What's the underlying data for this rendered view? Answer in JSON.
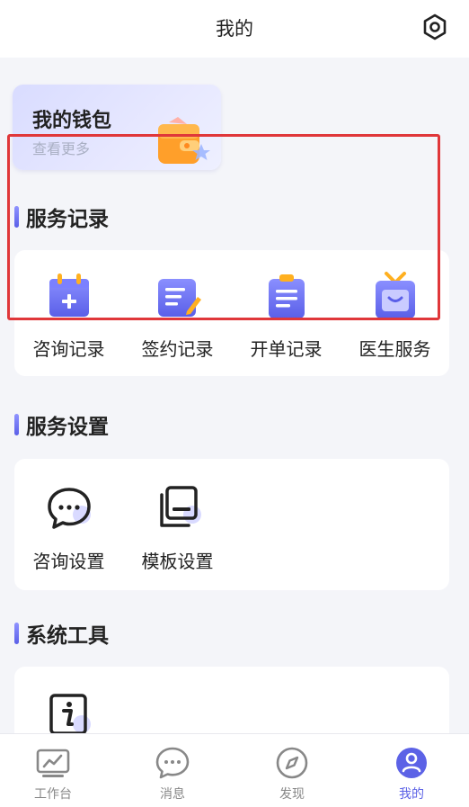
{
  "header": {
    "title": "我的",
    "settings_icon": "hexagon-settings-icon"
  },
  "wallet": {
    "title": "我的钱包",
    "subtitle": "查看更多",
    "icon": "wallet-icon"
  },
  "sections": {
    "service_records": {
      "title": "服务记录",
      "items": [
        {
          "label": "咨询记录",
          "icon": "calendar-plus-icon"
        },
        {
          "label": "签约记录",
          "icon": "sign-document-icon"
        },
        {
          "label": "开单记录",
          "icon": "clipboard-list-icon"
        },
        {
          "label": "医生服务",
          "icon": "doctor-service-icon"
        }
      ]
    },
    "service_settings": {
      "title": "服务设置",
      "items": [
        {
          "label": "咨询设置",
          "icon": "chat-settings-icon"
        },
        {
          "label": "模板设置",
          "icon": "template-settings-icon"
        }
      ]
    },
    "system_tools": {
      "title": "系统工具",
      "items": [
        {
          "label": "",
          "icon": "info-icon"
        }
      ]
    }
  },
  "tabbar": {
    "tabs": [
      {
        "label": "工作台",
        "icon": "workbench-icon",
        "active": false
      },
      {
        "label": "消息",
        "icon": "message-icon",
        "active": false
      },
      {
        "label": "发现",
        "icon": "compass-icon",
        "active": false
      },
      {
        "label": "我的",
        "icon": "profile-icon",
        "active": true
      }
    ]
  },
  "colors": {
    "accent": "#5c62e6",
    "highlight_border": "#e0373a",
    "page_background": "#f4f5f9"
  }
}
